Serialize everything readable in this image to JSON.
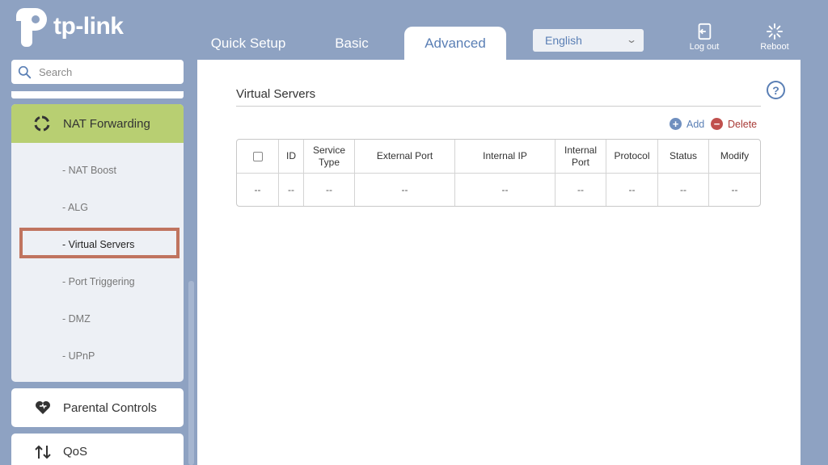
{
  "brand": {
    "name": "tp-link"
  },
  "nav": {
    "tabs": [
      {
        "label": "Quick Setup"
      },
      {
        "label": "Basic"
      },
      {
        "label": "Advanced",
        "active": true
      }
    ],
    "language": "English",
    "logout_label": "Log out",
    "reboot_label": "Reboot"
  },
  "sidebar": {
    "search_placeholder": "Search",
    "section": {
      "label": "NAT Forwarding",
      "items": [
        {
          "label": "- NAT Boost"
        },
        {
          "label": "- ALG"
        },
        {
          "label": "- Virtual Servers",
          "active": true
        },
        {
          "label": "- Port Triggering"
        },
        {
          "label": "- DMZ"
        },
        {
          "label": "- UPnP"
        }
      ]
    },
    "other": [
      {
        "label": "Parental Controls",
        "icon": "heart-icon"
      },
      {
        "label": "QoS",
        "icon": "up-down-arrows-icon"
      }
    ]
  },
  "main": {
    "title": "Virtual Servers",
    "help_label": "?",
    "actions": {
      "add": "Add",
      "delete": "Delete"
    },
    "table": {
      "headers": [
        "",
        "ID",
        "Service Type",
        "External Port",
        "Internal IP",
        "Internal Port",
        "Protocol",
        "Status",
        "Modify"
      ],
      "rows": [
        [
          "--",
          "--",
          "--",
          "--",
          "--",
          "--",
          "--",
          "--",
          "--"
        ]
      ]
    }
  },
  "colors": {
    "background": "#8ea2c2",
    "accent": "#5a7fb5",
    "active_section": "#b8cf72",
    "delete": "#c0504d",
    "highlight": "#c0745f"
  }
}
